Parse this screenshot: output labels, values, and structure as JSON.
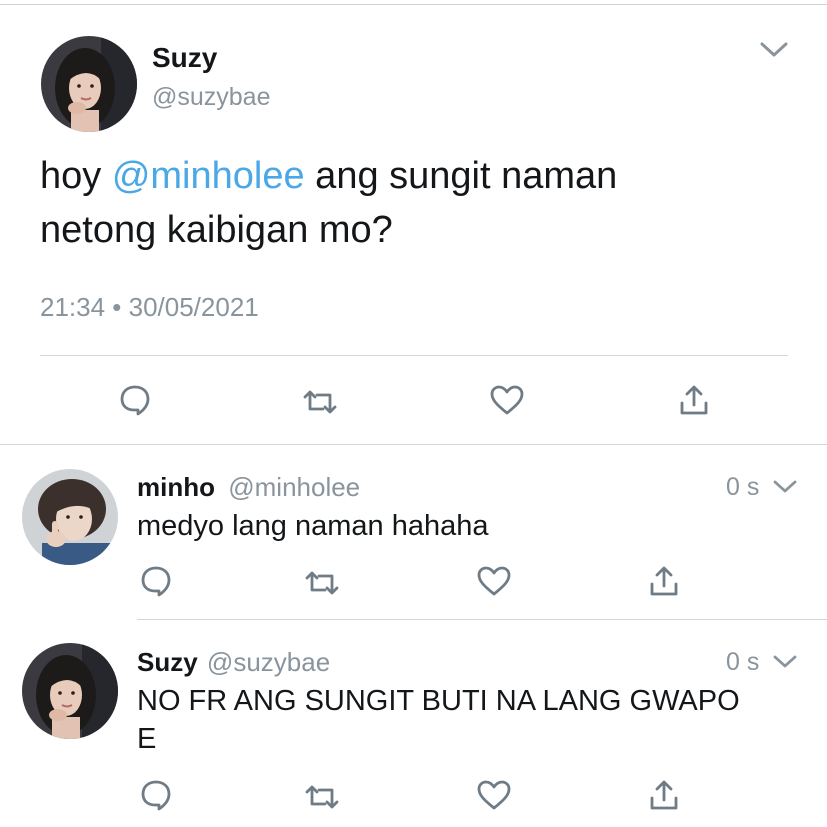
{
  "main_tweet": {
    "display_name": "Suzy",
    "handle": "@suzybae",
    "text_prefix": "hoy ",
    "mention": "@minholee",
    "text_line1_rest": " ang sungit naman",
    "text_line2": "netong kaibigan mo?",
    "timestamp": "21:34 • 30/05/2021",
    "actions": [
      "reply-icon",
      "retweet-icon",
      "like-icon",
      "share-icon"
    ]
  },
  "replies": [
    {
      "display_name": "minho",
      "handle": "@minholee",
      "time": "0 s",
      "text_line1": "medyo lang naman hahaha",
      "text_line2": ""
    },
    {
      "display_name": "Suzy",
      "handle": "@suzybae",
      "time": "0 s",
      "text_line1": "NO FR ANG SUNGIT BUTI NA LANG GWAPO",
      "text_line2": "E"
    }
  ],
  "colors": {
    "mention": "#4ba8e6",
    "secondary_text": "#8a949c",
    "icon": "#6f7b85",
    "divider": "#d3d7db"
  }
}
